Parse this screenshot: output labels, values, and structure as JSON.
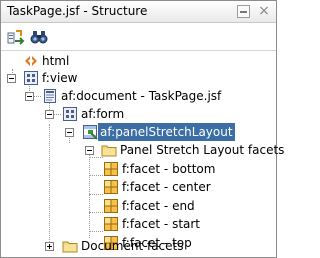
{
  "window": {
    "title": "TaskPage.jsf - Structure",
    "close_glyph": "×"
  },
  "toolbar": {
    "buttons": [
      {
        "name": "freeze-view-icon"
      },
      {
        "name": "find-binoculars-icon"
      }
    ]
  },
  "tree": {
    "nodes": [
      {
        "label": "html",
        "icon": "html-tag-icon"
      },
      {
        "label": "f:view",
        "icon": "component-icon"
      },
      {
        "label": "af:document - TaskPage.jsf",
        "icon": "document-icon"
      },
      {
        "label": "af:form",
        "icon": "component-icon"
      },
      {
        "label": "af:panelStretchLayout",
        "icon": "panel-layout-icon",
        "selected": true
      },
      {
        "label": "Panel Stretch Layout facets",
        "icon": "folder-icon"
      },
      {
        "label": "f:facet - bottom",
        "icon": "facet-icon"
      },
      {
        "label": "f:facet - center",
        "icon": "facet-icon"
      },
      {
        "label": "f:facet - end",
        "icon": "facet-icon"
      },
      {
        "label": "f:facet - start",
        "icon": "facet-icon"
      },
      {
        "label": "f:facet - top",
        "icon": "facet-icon"
      },
      {
        "label": "Document facets",
        "icon": "folder-icon"
      }
    ]
  },
  "colors": {
    "selection": "#3a6ea5",
    "folder": "#e8c860",
    "facet": "#e8a020"
  }
}
